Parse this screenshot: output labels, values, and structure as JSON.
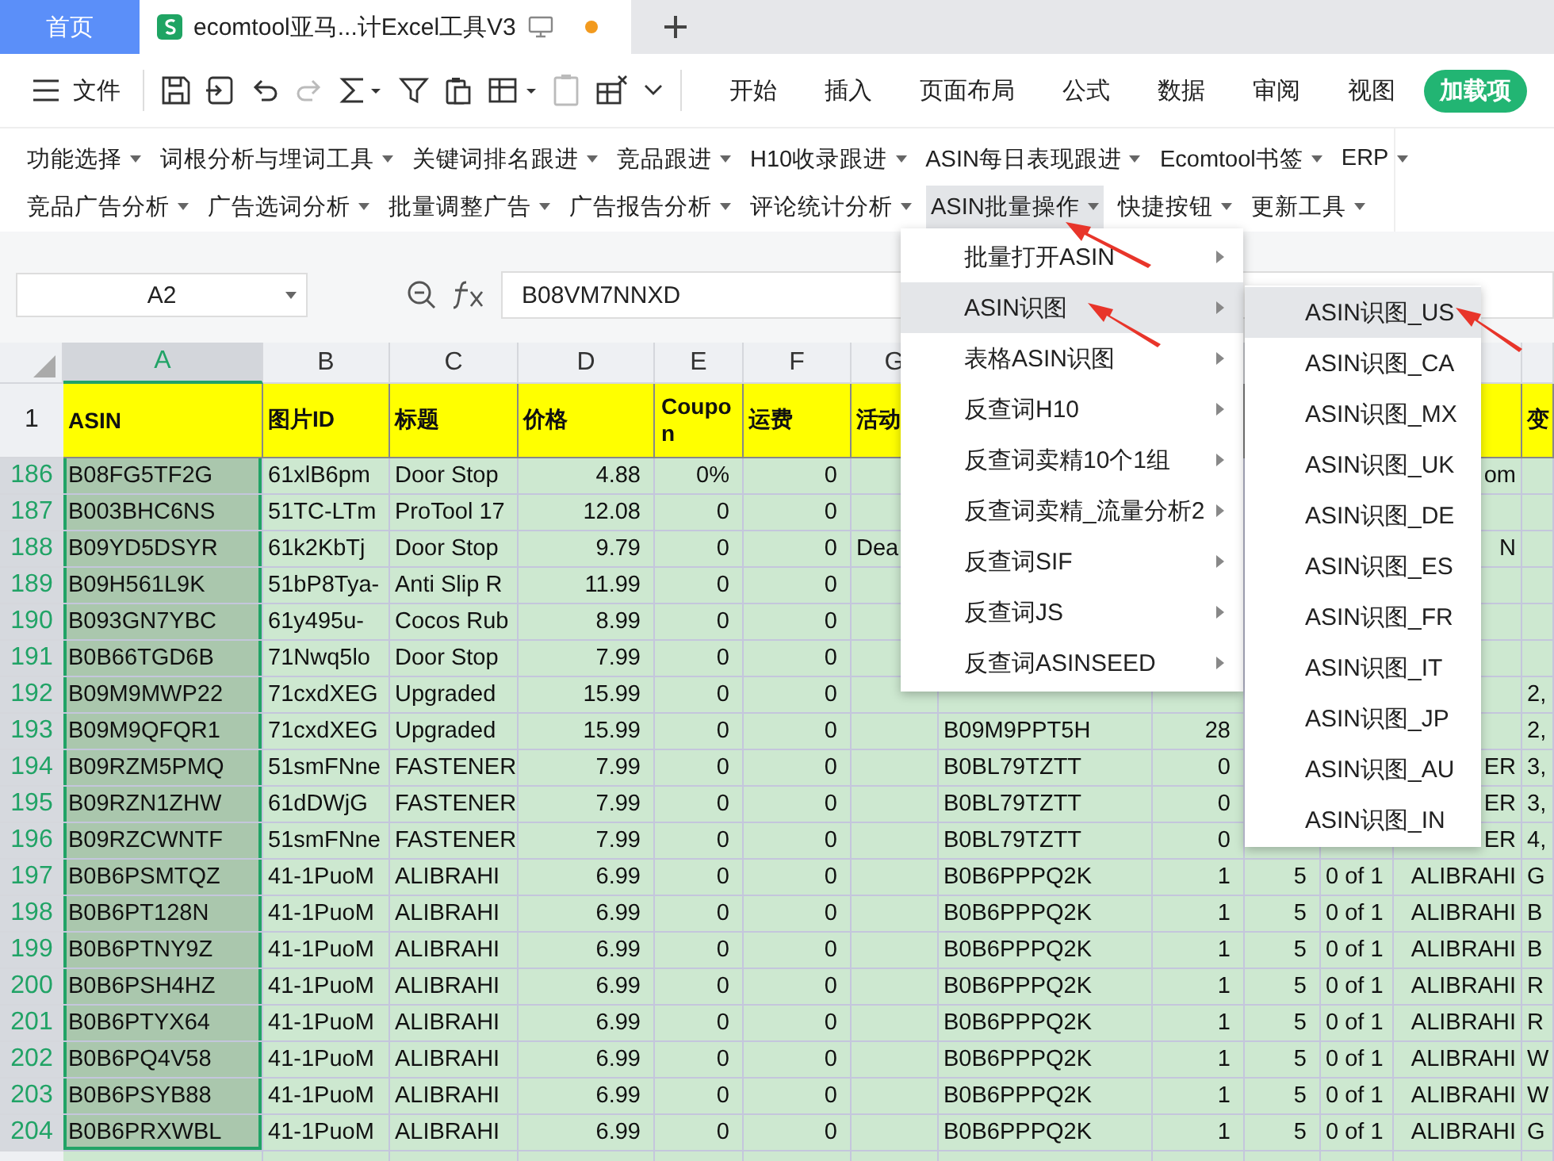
{
  "tabs": [
    {
      "kind": "home",
      "label": "首页",
      "selected": false
    },
    {
      "kind": "document",
      "label": "ecomtool亚马...计Excel工具V3",
      "selected": true,
      "unsaved": true
    }
  ],
  "file_menu": "文件",
  "ribbon_tabs": [
    {
      "label": "开始",
      "selected": false
    },
    {
      "label": "插入",
      "selected": false
    },
    {
      "label": "页面布局",
      "selected": false
    },
    {
      "label": "公式",
      "selected": false
    },
    {
      "label": "数据",
      "selected": false
    },
    {
      "label": "审阅",
      "selected": false
    },
    {
      "label": "视图",
      "selected": false
    },
    {
      "label": "加载项",
      "selected": true
    }
  ],
  "addin_rows": [
    [
      {
        "label": "功能选择",
        "selected": false
      },
      {
        "label": "词根分析与埋词工具",
        "selected": false
      },
      {
        "label": "关键词排名跟进",
        "selected": false
      },
      {
        "label": "竞品跟进",
        "selected": false
      },
      {
        "label": "H10收录跟进",
        "selected": false
      },
      {
        "label": "ASIN每日表现跟进",
        "selected": false
      },
      {
        "label": "Ecomtool书签",
        "selected": false
      },
      {
        "label": "ERP",
        "selected": false
      }
    ],
    [
      {
        "label": "竞品广告分析",
        "selected": false
      },
      {
        "label": "广告选词分析",
        "selected": false
      },
      {
        "label": "批量调整广告",
        "selected": false
      },
      {
        "label": "广告报告分析",
        "selected": false
      },
      {
        "label": "评论统计分析",
        "selected": false
      },
      {
        "label": "ASIN批量操作",
        "selected": true
      },
      {
        "label": "快捷按钮",
        "selected": false
      },
      {
        "label": "更新工具",
        "selected": false
      }
    ]
  ],
  "name_box": "A2",
  "formula": "B08VM7NNXD",
  "column_letters": [
    {
      "label": "A",
      "selected": true
    },
    {
      "label": "B",
      "selected": false
    },
    {
      "label": "C",
      "selected": false
    },
    {
      "label": "D",
      "selected": false
    },
    {
      "label": "E",
      "selected": false
    },
    {
      "label": "F",
      "selected": false
    },
    {
      "label": "G",
      "selected": false
    }
  ],
  "header_row": {
    "number": "1",
    "selected": false,
    "cells": {
      "A": "ASIN",
      "B": "图片ID",
      "C": "标题",
      "D": "价格",
      "E": "Coupon",
      "F": "运费",
      "G": "活动",
      "M": "变"
    }
  },
  "rows": [
    {
      "number": "186",
      "selected": true,
      "cells": {
        "A": "B08FG5TF2G",
        "B": "61xlB6pm",
        "C": "Door Stop",
        "D": "4.88",
        "E": "0%",
        "F": "0",
        "L": "om"
      }
    },
    {
      "number": "187",
      "selected": true,
      "cells": {
        "A": "B003BHC6NS",
        "B": "51TC-LTm",
        "C": "ProTool 17",
        "D": "12.08",
        "E": "0",
        "F": "0"
      }
    },
    {
      "number": "188",
      "selected": true,
      "cells": {
        "A": "B09YD5DSYR",
        "B": "61k2KbTj",
        "C": "Door Stop",
        "D": "9.79",
        "E": "0",
        "F": "0",
        "G": "Dea",
        "L": "N"
      }
    },
    {
      "number": "189",
      "selected": true,
      "cells": {
        "A": "B09H561L9K",
        "B": "51bP8Tya-",
        "C": "Anti Slip R",
        "D": "11.99",
        "E": "0",
        "F": "0"
      }
    },
    {
      "number": "190",
      "selected": true,
      "cells": {
        "A": "B093GN7YBC",
        "B": "61y495u-",
        "C": "Cocos Rub",
        "D": "8.99",
        "E": "0",
        "F": "0"
      }
    },
    {
      "number": "191",
      "selected": true,
      "cells": {
        "A": "B0B66TGD6B",
        "B": "71Nwq5lo",
        "C": "Door Stop",
        "D": "7.99",
        "E": "0",
        "F": "0"
      }
    },
    {
      "number": "192",
      "selected": true,
      "cells": {
        "A": "B09M9MWP22",
        "B": "71cxdXEG",
        "C": "Upgraded",
        "D": "15.99",
        "E": "0",
        "F": "0",
        "M": "2,"
      }
    },
    {
      "number": "193",
      "selected": true,
      "cells": {
        "A": "B09M9QFQR1",
        "B": "71cxdXEG",
        "C": "Upgraded",
        "D": "15.99",
        "E": "0",
        "F": "0",
        "H": "B09M9PPT5H",
        "I": "28",
        "M": "2,"
      }
    },
    {
      "number": "194",
      "selected": true,
      "cells": {
        "A": "B09RZM5PMQ",
        "B": "51smFNne",
        "C": "FASTENER",
        "D": "7.99",
        "E": "0",
        "F": "0",
        "H": "B0BL79TZTT",
        "I": "0",
        "L": "ER",
        "M": "3,"
      }
    },
    {
      "number": "195",
      "selected": true,
      "cells": {
        "A": "B09RZN1ZHW",
        "B": "61dDWjG",
        "C": "FASTENER",
        "D": "7.99",
        "E": "0",
        "F": "0",
        "H": "B0BL79TZTT",
        "I": "0",
        "L": "ER",
        "M": "3,"
      }
    },
    {
      "number": "196",
      "selected": true,
      "cells": {
        "A": "B09RZCWNTF",
        "B": "51smFNne",
        "C": "FASTENER",
        "D": "7.99",
        "E": "0",
        "F": "0",
        "H": "B0BL79TZTT",
        "I": "0",
        "L": "ER",
        "M": "4,"
      }
    },
    {
      "number": "197",
      "selected": true,
      "cells": {
        "A": "B0B6PSMTQZ",
        "B": "41-1PuoM",
        "C": "ALIBRAHI",
        "D": "6.99",
        "E": "0",
        "F": "0",
        "H": "B0B6PPPQ2K",
        "I": "1",
        "J": "5",
        "K": "0 of 1",
        "L": "ALIBRAHI",
        "M": "G"
      }
    },
    {
      "number": "198",
      "selected": true,
      "cells": {
        "A": "B0B6PT128N",
        "B": "41-1PuoM",
        "C": "ALIBRAHI",
        "D": "6.99",
        "E": "0",
        "F": "0",
        "H": "B0B6PPPQ2K",
        "I": "1",
        "J": "5",
        "K": "0 of 1",
        "L": "ALIBRAHI",
        "M": "B"
      }
    },
    {
      "number": "199",
      "selected": true,
      "cells": {
        "A": "B0B6PTNY9Z",
        "B": "41-1PuoM",
        "C": "ALIBRAHI",
        "D": "6.99",
        "E": "0",
        "F": "0",
        "H": "B0B6PPPQ2K",
        "I": "1",
        "J": "5",
        "K": "0 of 1",
        "L": "ALIBRAHI",
        "M": "B"
      }
    },
    {
      "number": "200",
      "selected": true,
      "cells": {
        "A": "B0B6PSH4HZ",
        "B": "41-1PuoM",
        "C": "ALIBRAHI",
        "D": "6.99",
        "E": "0",
        "F": "0",
        "H": "B0B6PPPQ2K",
        "I": "1",
        "J": "5",
        "K": "0 of 1",
        "L": "ALIBRAHI",
        "M": "R"
      }
    },
    {
      "number": "201",
      "selected": true,
      "cells": {
        "A": "B0B6PTYX64",
        "B": "41-1PuoM",
        "C": "ALIBRAHI",
        "D": "6.99",
        "E": "0",
        "F": "0",
        "H": "B0B6PPPQ2K",
        "I": "1",
        "J": "5",
        "K": "0 of 1",
        "L": "ALIBRAHI",
        "M": "R"
      }
    },
    {
      "number": "202",
      "selected": true,
      "cells": {
        "A": "B0B6PQ4V58",
        "B": "41-1PuoM",
        "C": "ALIBRAHI",
        "D": "6.99",
        "E": "0",
        "F": "0",
        "H": "B0B6PPPQ2K",
        "I": "1",
        "J": "5",
        "K": "0 of 1",
        "L": "ALIBRAHI",
        "M": "W"
      }
    },
    {
      "number": "203",
      "selected": true,
      "cells": {
        "A": "B0B6PSYB88",
        "B": "41-1PuoM",
        "C": "ALIBRAHI",
        "D": "6.99",
        "E": "0",
        "F": "0",
        "H": "B0B6PPPQ2K",
        "I": "1",
        "J": "5",
        "K": "0 of 1",
        "L": "ALIBRAHI",
        "M": "W"
      }
    },
    {
      "number": "204",
      "selected": true,
      "cells": {
        "A": "B0B6PRXWBL",
        "B": "41-1PuoM",
        "C": "ALIBRAHI",
        "D": "6.99",
        "E": "0",
        "F": "0",
        "H": "B0B6PPPQ2K",
        "I": "1",
        "J": "5",
        "K": "0 of 1",
        "L": "ALIBRAHI",
        "M": "G"
      }
    }
  ],
  "context_menu": {
    "items": [
      {
        "label": "批量打开ASIN",
        "selected": false
      },
      {
        "label": "ASIN识图",
        "selected": true
      },
      {
        "label": "表格ASIN识图",
        "selected": false
      },
      {
        "label": "反查词H10",
        "selected": false
      },
      {
        "label": "反查词卖精10个1组",
        "selected": false
      },
      {
        "label": "反查词卖精_流量分析2",
        "selected": false
      },
      {
        "label": "反查词SIF",
        "selected": false
      },
      {
        "label": "反查词JS",
        "selected": false
      },
      {
        "label": "反查词ASINSEED",
        "selected": false
      }
    ]
  },
  "submenu": {
    "items": [
      {
        "label": "ASIN识图_US",
        "selected": true
      },
      {
        "label": "ASIN识图_CA",
        "selected": false
      },
      {
        "label": "ASIN识图_MX",
        "selected": false
      },
      {
        "label": "ASIN识图_UK",
        "selected": false
      },
      {
        "label": "ASIN识图_DE",
        "selected": false
      },
      {
        "label": "ASIN识图_ES",
        "selected": false
      },
      {
        "label": "ASIN识图_FR",
        "selected": false
      },
      {
        "label": "ASIN识图_IT",
        "selected": false
      },
      {
        "label": "ASIN识图_JP",
        "selected": false
      },
      {
        "label": "ASIN识图_AU",
        "selected": false
      },
      {
        "label": "ASIN识图_IN",
        "selected": false
      }
    ]
  }
}
